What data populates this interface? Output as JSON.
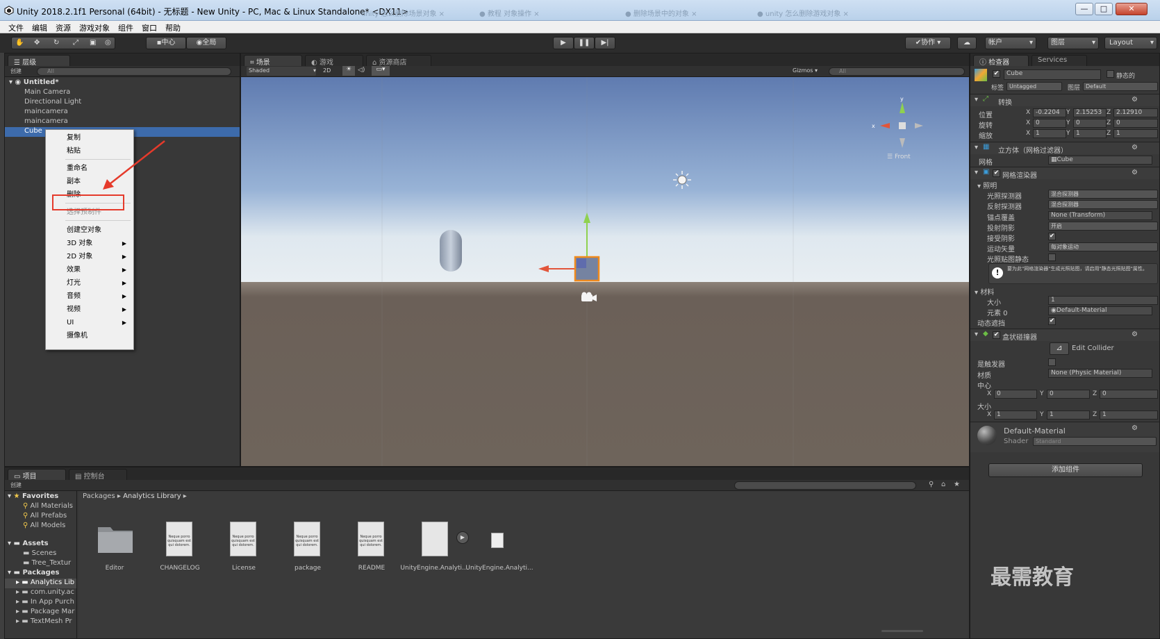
{
  "window": {
    "title": "Unity 2018.2.1f1 Personal (64bit) - 无标题 - New Unity - PC, Mac & Linux Standalone* <DX11>",
    "buttons": {
      "minimize": "—",
      "maximize": "□",
      "close": "✕"
    }
  },
  "menu": [
    "文件",
    "编辑",
    "资源",
    "游戏对象",
    "组件",
    "窗口",
    "帮助"
  ],
  "toolbar": {
    "pivot": "中心",
    "space": "全局",
    "collab": "协作",
    "account": "帐户",
    "layers": "图层",
    "layout": "Layout"
  },
  "hierarchy": {
    "tab": "层级",
    "create": "创建",
    "search_placeholder": "All",
    "scene": "Untitled*",
    "items": [
      "Main Camera",
      "Directional Light",
      "maincamera",
      "maincamera",
      "Cube"
    ],
    "selected_index": 4
  },
  "context_menu": {
    "items": [
      "复制",
      "粘贴",
      "重命名",
      "副本",
      "删除",
      "选择预制件",
      "创建空对象",
      "3D 对象",
      "2D 对象",
      "效果",
      "灯光",
      "音频",
      "视频",
      "UI",
      "摄像机"
    ],
    "highlighted": "删除",
    "disabled": "选择预制件"
  },
  "scene_view": {
    "tabs": [
      "场景",
      "游戏",
      "资源商店"
    ],
    "shading": "Shaded",
    "mode_2d": "2D",
    "gizmos": "Gizmos",
    "search_placeholder": "All",
    "orientation_label": "Front"
  },
  "inspector": {
    "tabs": [
      "检查器",
      "Services"
    ],
    "object_name": "Cube",
    "static_label": "静态的",
    "tag_label": "标签",
    "tag_value": "Untagged",
    "layer_label": "图层",
    "layer_value": "Default",
    "transform": {
      "title": "转换",
      "position_label": "位置",
      "position": [
        "-0.2204",
        "2.15253",
        "2.12910"
      ],
      "rotation_label": "旋转",
      "rotation": [
        "0",
        "0",
        "0"
      ],
      "scale_label": "缩放",
      "scale": [
        "1",
        "1",
        "1"
      ]
    },
    "mesh_filter": {
      "title": "立方体（网格过滤器）",
      "mesh_label": "网格",
      "mesh_value": "Cube"
    },
    "mesh_renderer": {
      "title": "网格渲染器",
      "lighting_label": "照明",
      "light_probes_label": "光照探测器",
      "light_probes_value": "混合探测器",
      "reflection_probes_label": "反射探测器",
      "reflection_probes_value": "混合探测器",
      "anchor_label": "锚点覆盖",
      "anchor_value": "None (Transform)",
      "cast_shadows_label": "投射阴影",
      "cast_shadows_value": "开启",
      "receive_shadows_label": "接受阴影",
      "motion_vectors_label": "运动矢量",
      "motion_vectors_value": "每对象运动",
      "lightmap_static_label": "光照贴图静态",
      "info": "要为此\"网格渲染器\"生成光照贴图，请启用\"静态光照贴图\"属性。",
      "materials_label": "材料",
      "size_label": "大小",
      "size_value": "1",
      "element_label": "元素 0",
      "element_value": "Default-Material",
      "dynamic_occlusion_label": "动态遮挡"
    },
    "box_collider": {
      "title": "盒状碰撞器",
      "edit_collider": "Edit Collider",
      "trigger_label": "是触发器",
      "material_label": "材质",
      "material_value": "None (Physic Material)",
      "center_label": "中心",
      "center": [
        "0",
        "0",
        "0"
      ],
      "size_label": "大小",
      "size": [
        "1",
        "1",
        "1"
      ]
    },
    "material": {
      "name": "Default-Material",
      "shader_label": "Shader",
      "shader_value": "Standard"
    },
    "add_component": "添加组件"
  },
  "project": {
    "tabs": [
      "项目",
      "控制台"
    ],
    "create": "创建",
    "favorites_label": "Favorites",
    "favorites": [
      "All Materials",
      "All Prefabs",
      "All Models"
    ],
    "assets_label": "Assets",
    "assets": [
      "Scenes",
      "Tree_Textur"
    ],
    "packages_label": "Packages",
    "packages": [
      "Analytics Lib",
      "com.unity.ac",
      "In App Purch",
      "Package Mar",
      "TextMesh Pr"
    ],
    "breadcrumb": [
      "Packages",
      "Analytics Library"
    ],
    "files": [
      "Editor",
      "CHANGELOG",
      "License",
      "package",
      "README",
      "UnityEngine.Analyti...",
      "UnityEngine.Analyti..."
    ],
    "doc_text": "Neque porro quisquam est qui dolorem."
  },
  "watermark": "最需教育",
  "colors": {
    "selection": "#3d6bab",
    "highlight_box": "#e53a2b",
    "sky_top": "#5f7bb0",
    "ground": "#6b6058"
  }
}
